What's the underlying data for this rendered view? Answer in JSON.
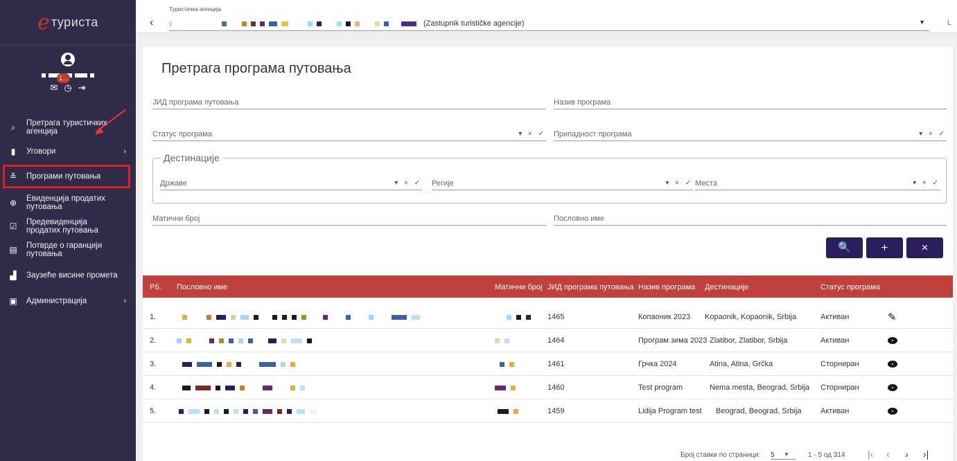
{
  "app": {
    "logo_mark": "e",
    "logo_text": "туриста",
    "badge": "1..."
  },
  "sidebar": {
    "items": [
      {
        "label": "Претрага туристичких агенција",
        "icon": "search-icon"
      },
      {
        "label": "Уговори",
        "icon": "document-icon"
      },
      {
        "label": "Програми путовања",
        "icon": "plane-icon"
      },
      {
        "label": "Евиденција продатих путовања",
        "icon": "ledger-icon"
      },
      {
        "label": "Предевиденција продатих путовања",
        "icon": "checkbox-icon"
      },
      {
        "label": "Потврде о гаранцији путовања",
        "icon": "certificate-icon"
      },
      {
        "label": "Заузеће висине промета",
        "icon": "bar-chart-icon"
      },
      {
        "label": "Администрација",
        "icon": "account-box-icon"
      }
    ]
  },
  "topbar": {
    "agency_label": "Туристичка агенција",
    "agency_suffix": "(Zastupnik turističke agencije)",
    "lang": "L"
  },
  "page": {
    "title": "Претрага програма путовања"
  },
  "form": {
    "jid_label": "ЈИД програма путовања",
    "name_label": "Назив програма",
    "status_label": "Статус програма",
    "belong_label": "Припадност програма",
    "dest_legend": "Дестинације",
    "countries_label": "Државе",
    "regions_label": "Регије",
    "places_label": "Места",
    "mb_label": "Матични број",
    "business_label": "Пословно име",
    "ctl_glyphs": "▾ × ✓"
  },
  "buttons": {
    "search": "🔍",
    "add": "+",
    "clear": "×"
  },
  "table": {
    "headers": [
      "Рб.",
      "Пословно име",
      "Матични број",
      "ЈИД програма путовања",
      "Назив програма",
      "Дестинације",
      "Статус програма"
    ],
    "rows": [
      {
        "rb": "1.",
        "jid": "1465",
        "name": "Копаоник 2023",
        "dest": "Kopaonik, Kopaonik, Srbija",
        "status": "Активан",
        "action": "edit"
      },
      {
        "rb": "2.",
        "jid": "1464",
        "name": "Програм зима 2023",
        "dest": "Zlatibor, Zlatibor, Srbija",
        "status": "Активан",
        "action": "view"
      },
      {
        "rb": "3.",
        "jid": "1461",
        "name": "Грчка 2024",
        "dest": "Atina, Atina, Grčka",
        "status": "Сторниран",
        "action": "view"
      },
      {
        "rb": "4.",
        "jid": "1460",
        "name": "Test program",
        "dest": "Nema mesta, Beograd, Srbija",
        "status": "Сторниран",
        "action": "view"
      },
      {
        "rb": "5.",
        "jid": "1459",
        "name": "Lidija Program test",
        "dest": "Beograd, Beograd, Srbija",
        "status": "Активан",
        "action": "view"
      }
    ]
  },
  "pager": {
    "per_page_label": "Број ставки по страници:",
    "per_page": "5",
    "range": "1 - 5 од 314"
  },
  "colors": {
    "sidebar": "#2f2b48",
    "accent": "#2a1f5c",
    "table_header": "#c0403c",
    "highlight": "#e02020"
  }
}
